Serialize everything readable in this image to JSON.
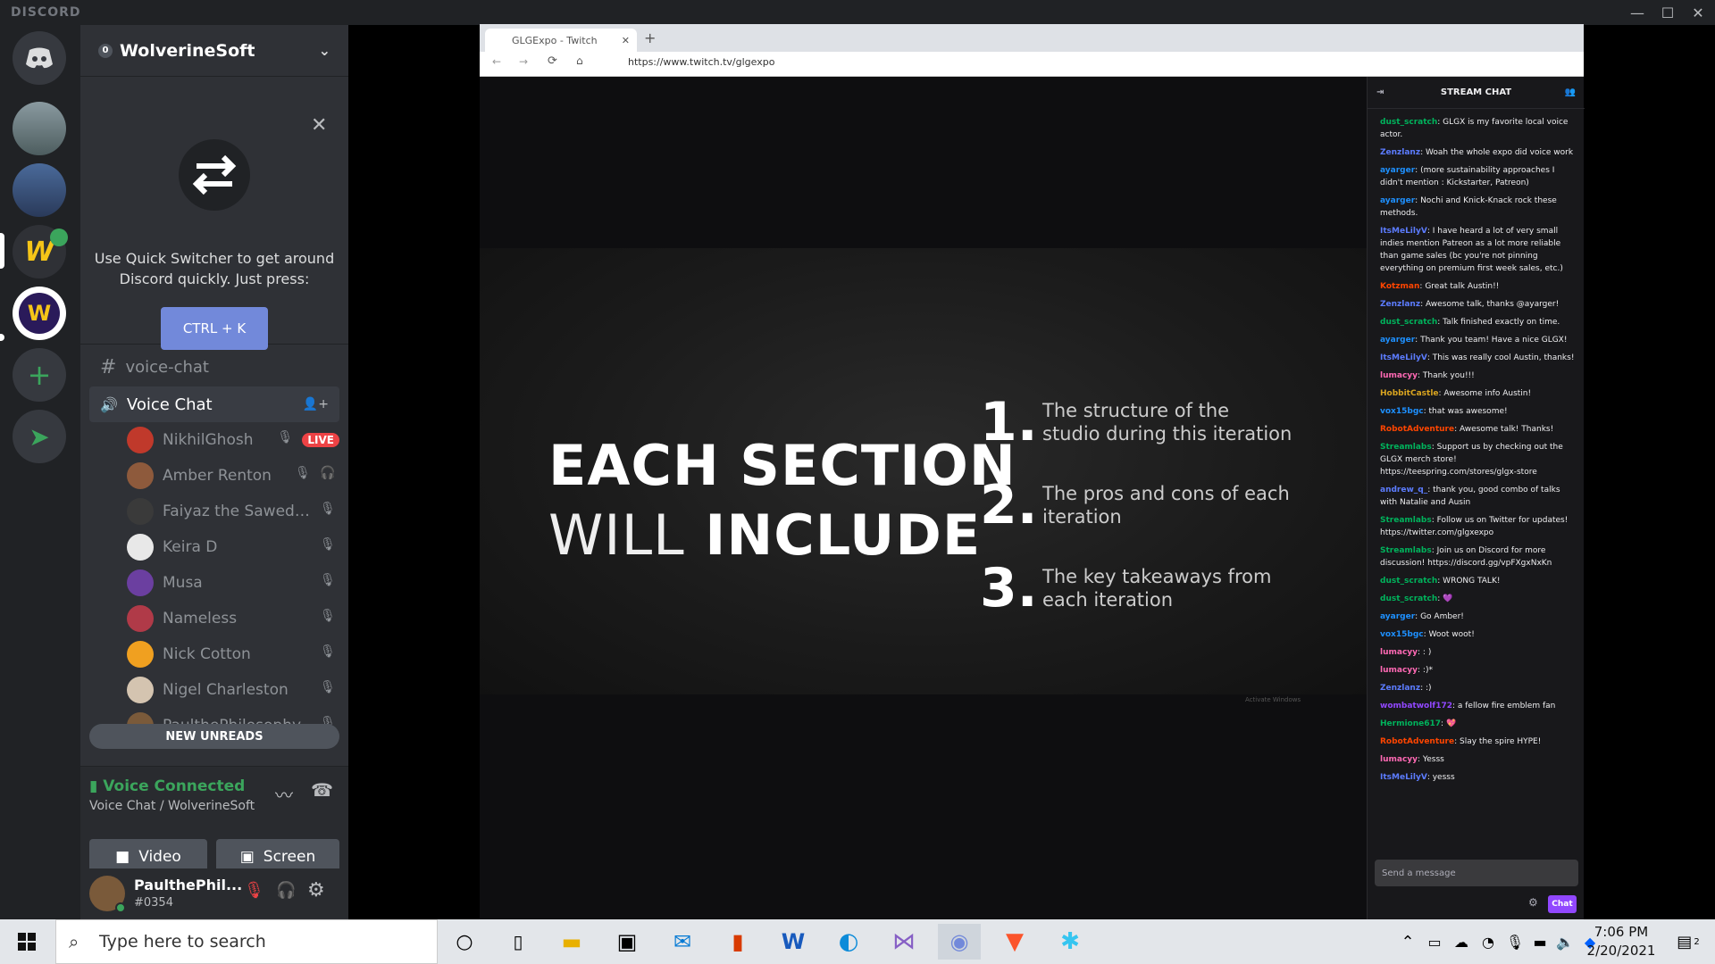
{
  "titlebar": {
    "logo": "DISCORD"
  },
  "server": {
    "name": "WolverineSoft",
    "badge": "0"
  },
  "quick_switcher": {
    "text": "Use Quick Switcher to get around\nDiscord quickly. Just press:",
    "shortcut": "CTRL + K"
  },
  "channels": {
    "text": {
      "name": "voice-chat"
    },
    "voice": {
      "name": "Voice Chat"
    }
  },
  "voice_users": [
    {
      "name": "NikhilGhosh",
      "live": "LIVE",
      "color": "#c0392b"
    },
    {
      "name": "Amber Renton",
      "color": "#8e5a3c"
    },
    {
      "name": "Faiyaz the Sawed of...",
      "color": "#3a3a3a"
    },
    {
      "name": "Keira D",
      "color": "#e8e8e8"
    },
    {
      "name": "Musa",
      "color": "#6b3fa0"
    },
    {
      "name": "Nameless",
      "color": "#b03a48"
    },
    {
      "name": "Nick Cotton",
      "color": "#f0a020"
    },
    {
      "name": "Nigel Charleston",
      "color": "#d4c4b0"
    },
    {
      "name": "PaulthePhilosophy...",
      "color": "#7a5a3a"
    }
  ],
  "new_unreads": "NEW UNREADS",
  "voice_connected": {
    "status": "Voice Connected",
    "location": "Voice Chat / WolverineSoft",
    "video": "Video",
    "screen": "Screen"
  },
  "user": {
    "name": "PaulthePhil...",
    "tag": "#0354"
  },
  "browser": {
    "tab_title": "GLGExpo - Twitch",
    "url": "https://www.twitch.tv/glgexpo"
  },
  "slide": {
    "headline_1": "EACH SECTION",
    "headline_2a": "WILL",
    "headline_2b": "INCLUDE",
    "points": [
      {
        "num": "1.",
        "text": "The structure of the studio during this iteration"
      },
      {
        "num": "2.",
        "text": "The pros and cons of each iteration"
      },
      {
        "num": "3.",
        "text": "The key takeaways from each iteration"
      }
    ],
    "watermark": "Activate Windows"
  },
  "stream_chat": {
    "title": "STREAM CHAT",
    "messages": [
      {
        "user": "dust_scratch",
        "color": "#00b35c",
        "text": "GLGX is my favorite local voice actor."
      },
      {
        "user": "Zenzlanz",
        "color": "#5c7cff",
        "text": "Woah the whole expo did voice work"
      },
      {
        "user": "ayarger",
        "color": "#1e90ff",
        "text": "(more sustainability approaches I didn't mention : Kickstarter, Patreon)"
      },
      {
        "user": "ayarger",
        "color": "#1e90ff",
        "text": "Nochi and Knick-Knack rock these methods."
      },
      {
        "user": "ItsMeLilyV",
        "color": "#5c7cff",
        "text": "I have heard a lot of very small indies mention Patreon as a lot more reliable than game sales (bc you're not pinning everything on premium first week sales, etc.)"
      },
      {
        "user": "Kotzman",
        "color": "#ff4500",
        "text": "Great talk Austin!!"
      },
      {
        "user": "Zenzlanz",
        "color": "#5c7cff",
        "text": "Awesome talk, thanks @ayarger!"
      },
      {
        "user": "dust_scratch",
        "color": "#00b35c",
        "text": "Talk finished exactly on time."
      },
      {
        "user": "ayarger",
        "color": "#1e90ff",
        "text": "Thank you team! Have a nice GLGX!"
      },
      {
        "user": "ItsMeLilyV",
        "color": "#5c7cff",
        "text": "This was really cool Austin, thanks!"
      },
      {
        "user": "lumacyy",
        "color": "#ff69b4",
        "text": "Thank you!!!"
      },
      {
        "user": "HobbitCastle",
        "color": "#daa520",
        "text": "Awesome info Austin!"
      },
      {
        "user": "vox15bgc",
        "color": "#1e90ff",
        "text": "that was awesome!"
      },
      {
        "user": "RobotAdventure",
        "color": "#ff4500",
        "text": "Awesome talk! Thanks!"
      },
      {
        "user": "Streamlabs",
        "color": "#00b35c",
        "text": "Support us by checking out the GLGX merch store! https://teespring.com/stores/glgx-store"
      },
      {
        "user": "andrew_q_",
        "color": "#5c7cff",
        "text": "thank you, good combo of talks with Natalie and Ausin"
      },
      {
        "user": "Streamlabs",
        "color": "#00b35c",
        "text": "Follow us on Twitter for updates! https://twitter.com/glgxexpo"
      },
      {
        "user": "Streamlabs",
        "color": "#00b35c",
        "text": "Join us on Discord for more discussion! https://discord.gg/vpFXgxNxKn"
      },
      {
        "user": "dust_scratch",
        "color": "#00b35c",
        "text": "WRONG TALK!"
      },
      {
        "user": "dust_scratch",
        "color": "#00b35c",
        "text": "💜"
      },
      {
        "user": "ayarger",
        "color": "#1e90ff",
        "text": "Go Amber!"
      },
      {
        "user": "vox15bgc",
        "color": "#1e90ff",
        "text": "Woot woot!"
      },
      {
        "user": "lumacyy",
        "color": "#ff69b4",
        "text": ": )"
      },
      {
        "user": "lumacyy",
        "color": "#ff69b4",
        "text": ":)*"
      },
      {
        "user": "Zenzlanz",
        "color": "#5c7cff",
        "text": ":)"
      },
      {
        "user": "wombatwolf172",
        "color": "#9147ff",
        "text": "a fellow fire emblem fan"
      },
      {
        "user": "Hermione617",
        "color": "#00b35c",
        "text": "💖"
      },
      {
        "user": "RobotAdventure",
        "color": "#ff4500",
        "text": "Slay the spire HYPE!"
      },
      {
        "user": "lumacyy",
        "color": "#ff69b4",
        "text": "Yesss"
      },
      {
        "user": "ItsMeLilyV",
        "color": "#5c7cff",
        "text": "yesss"
      }
    ],
    "input_placeholder": "Send a message",
    "chat_button": "Chat"
  },
  "taskbar": {
    "search_placeholder": "Type here to search",
    "time": "7:06 PM",
    "date": "2/20/2021",
    "notifications": "2"
  }
}
